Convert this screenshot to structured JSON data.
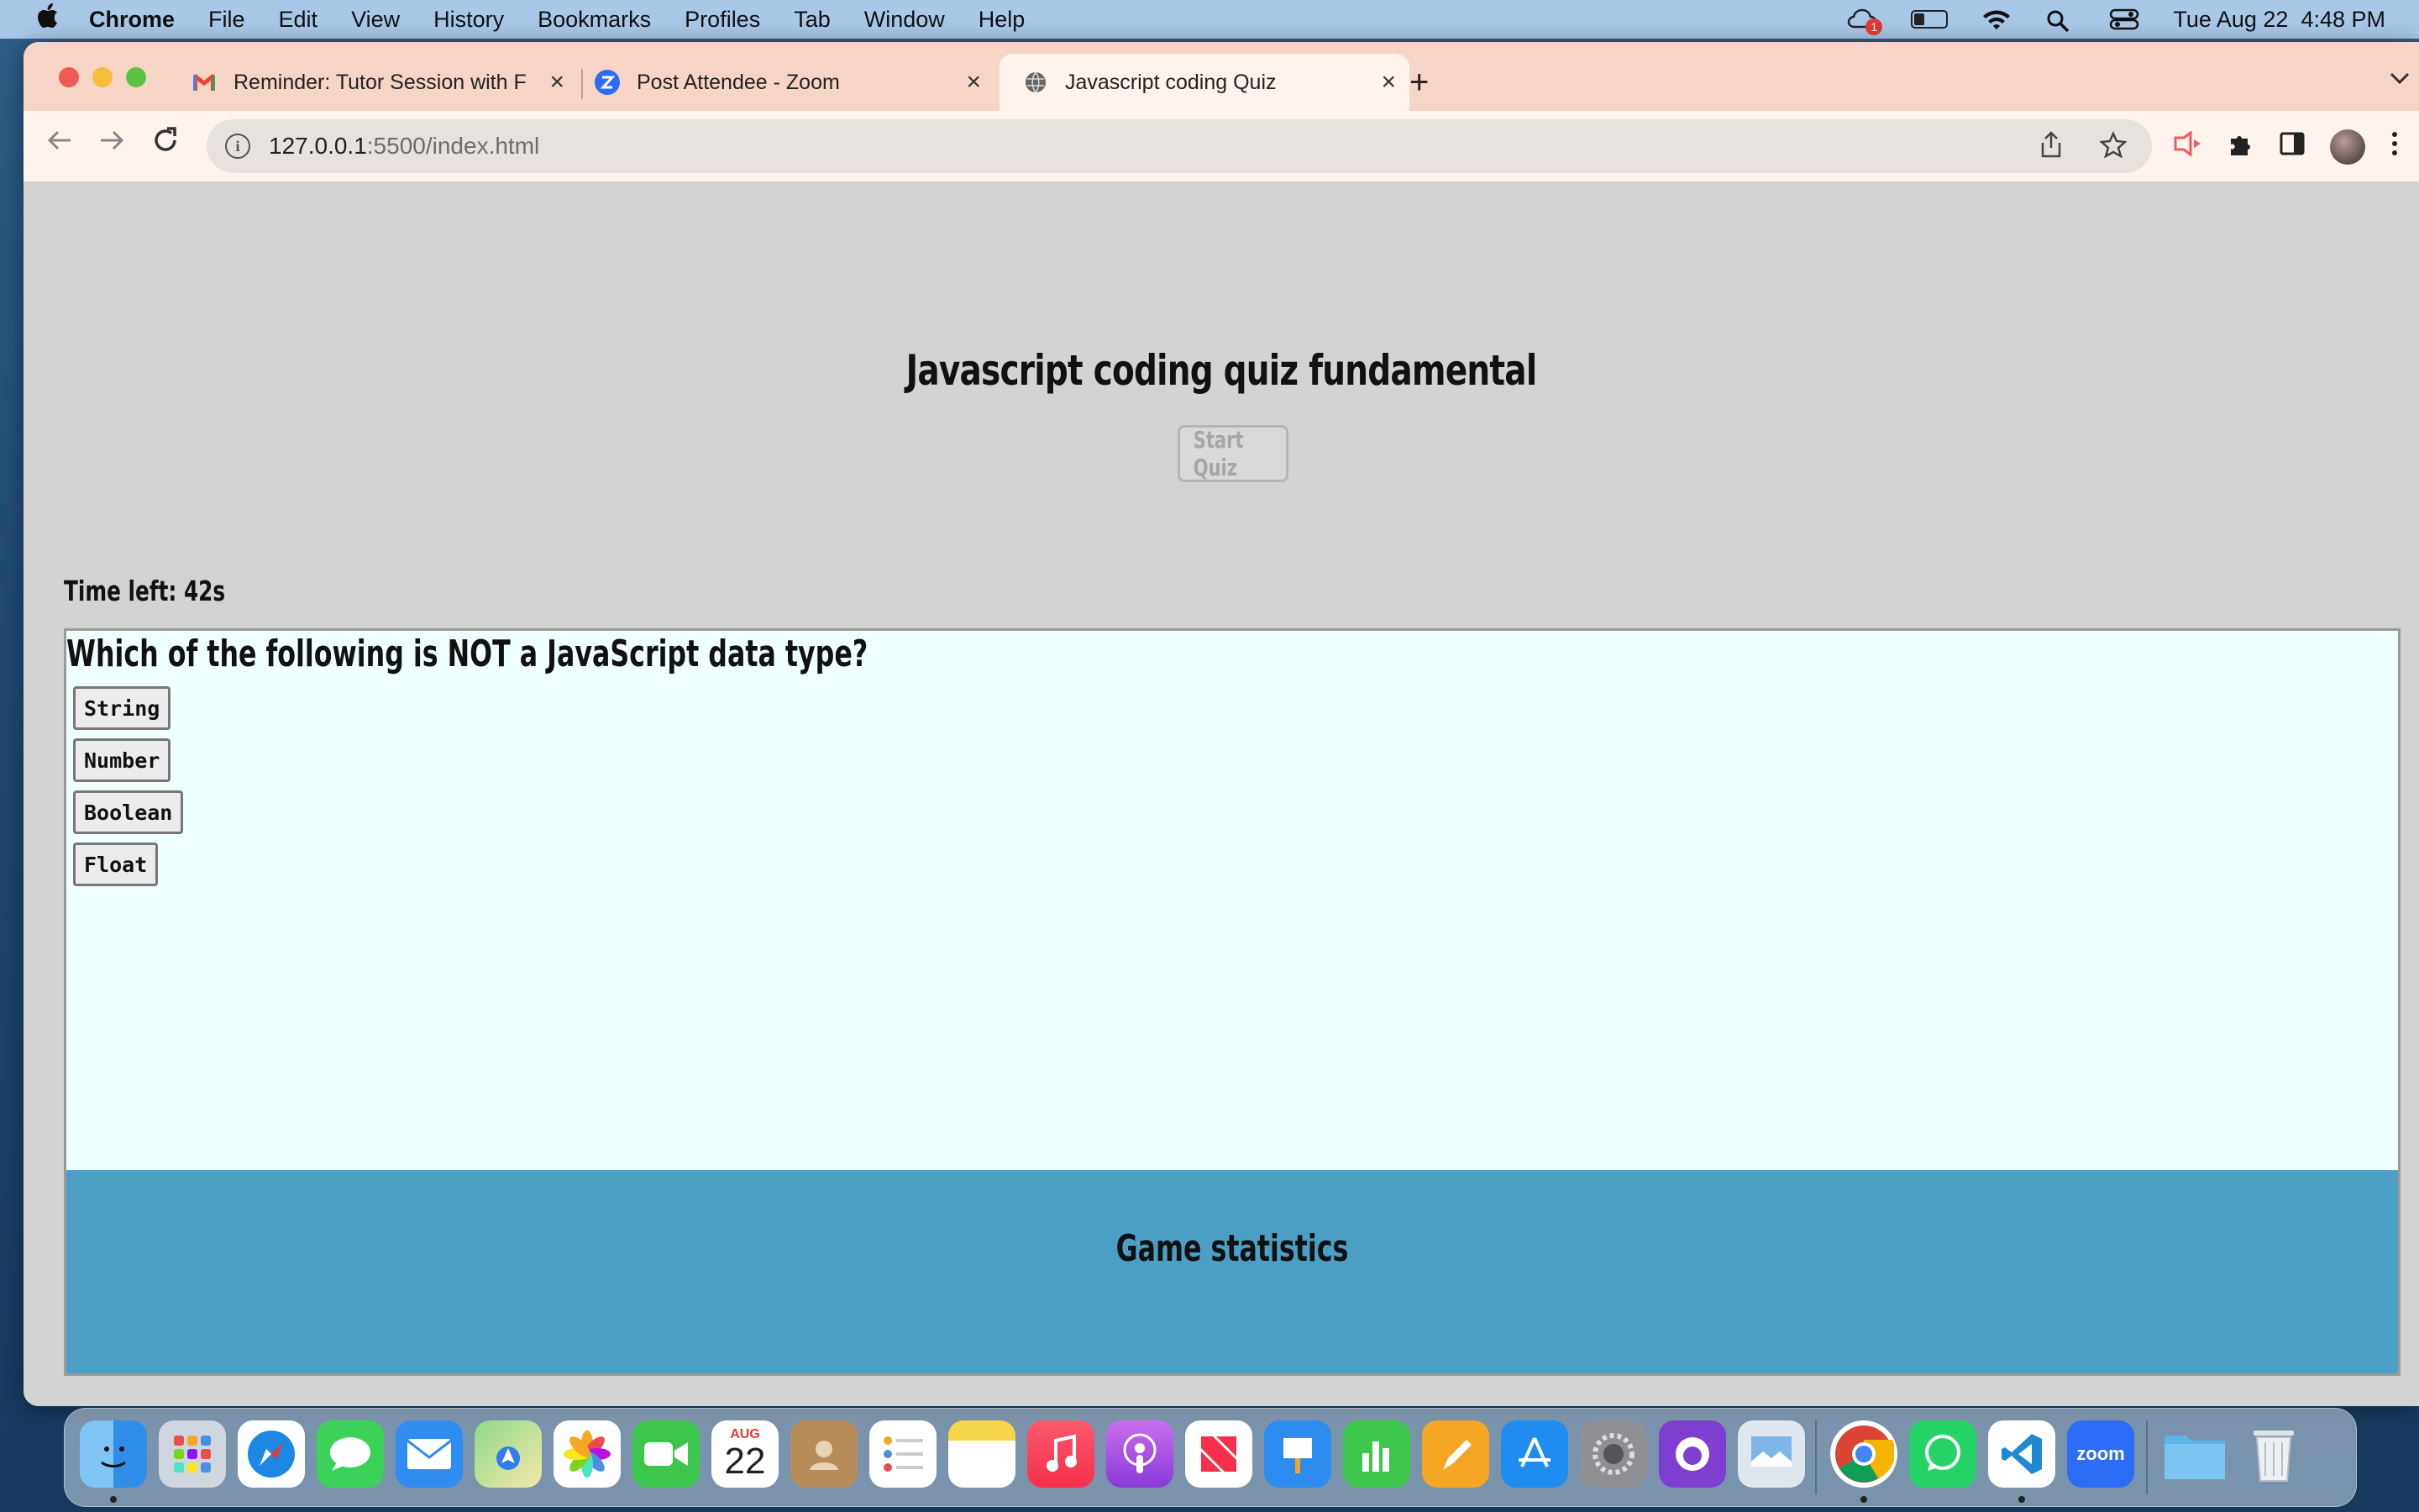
{
  "menubar": {
    "app_name": "Chrome",
    "items": [
      "File",
      "Edit",
      "View",
      "History",
      "Bookmarks",
      "Profiles",
      "Tab",
      "Window",
      "Help"
    ],
    "cloud_badge": "1",
    "datetime": "Tue Aug 22  4:48 PM",
    "icons": [
      "apple-icon",
      "creative-cloud-icon",
      "battery-icon",
      "wifi-icon",
      "spotlight-icon",
      "control-center-icon"
    ]
  },
  "browser": {
    "tabs": [
      {
        "title": "Reminder: Tutor Session with F",
        "icon": "gmail-icon"
      },
      {
        "title": "Post Attendee - Zoom",
        "icon": "zoom-icon"
      },
      {
        "title": "Javascript coding Quiz",
        "icon": "globe-icon",
        "active": true
      }
    ],
    "url_host": "127.0.0.1",
    "url_rest": ":5500/index.html"
  },
  "page": {
    "title": "Javascript coding quiz fundamental",
    "start_button": "Start Quiz",
    "timer": "Time left: 42s",
    "question": "Which of the following is NOT a JavaScript data type?",
    "choices": [
      "String",
      "Number",
      "Boolean",
      "Float"
    ],
    "stats_title": "Game statistics",
    "colors": {
      "background": "#d3d3d3",
      "quiz_bg": "#f0ffff",
      "stats_bg": "#4b9fc5"
    }
  },
  "dock": {
    "apps": [
      "Finder",
      "Launchpad",
      "Safari",
      "Messages",
      "Mail",
      "Maps",
      "Photos",
      "FaceTime",
      "Calendar",
      "Contacts",
      "Reminders",
      "Notes",
      "Music",
      "Podcasts",
      "News",
      "Keynote",
      "Numbers",
      "Pages",
      "App Store",
      "System Settings",
      "GitHub Desktop",
      "Preview",
      "Chrome",
      "WhatsApp",
      "VS Code",
      "Zoom",
      "Downloads",
      "Trash"
    ],
    "calendar_month": "AUG",
    "calendar_day": "22",
    "zoom_label": "zoom"
  }
}
